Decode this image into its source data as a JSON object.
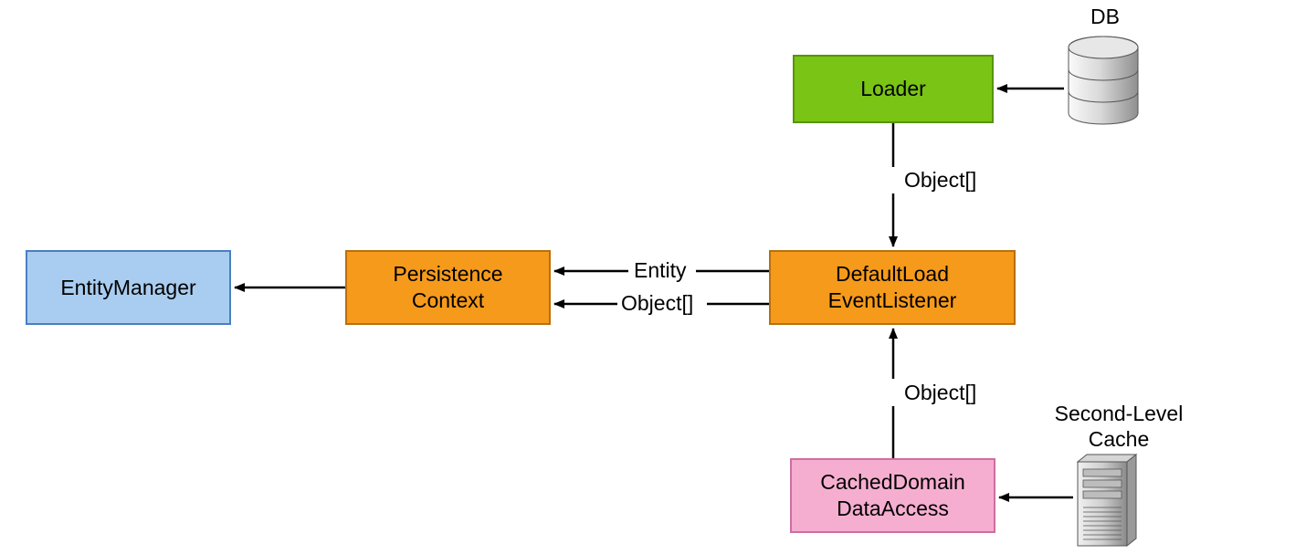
{
  "boxes": {
    "entityManager": {
      "label": "EntityManager",
      "fill": "#a9cdf0",
      "stroke": "#4a7ec2"
    },
    "persistenceContext": {
      "label": "Persistence\nContext",
      "fill": "#f59a1b",
      "stroke": "#b86f0d"
    },
    "defaultLoadEventListener": {
      "label": "DefaultLoad\nEventListener",
      "fill": "#f59a1b",
      "stroke": "#b86f0d"
    },
    "loader": {
      "label": "Loader",
      "fill": "#7ac415",
      "stroke": "#569408"
    },
    "cachedDomainDataAccess": {
      "label": "CachedDomain\nDataAccess",
      "fill": "#f6aed0",
      "stroke": "#cc6f9f"
    }
  },
  "edgeLabels": {
    "loaderToListener": "Object[]",
    "listenerToPersistenceEntity": "Entity",
    "listenerToPersistenceObject": "Object[]",
    "cacheToListener": "Object[]"
  },
  "externalLabels": {
    "db": "DB",
    "secondLevelCache": "Second-Level\nCache"
  }
}
